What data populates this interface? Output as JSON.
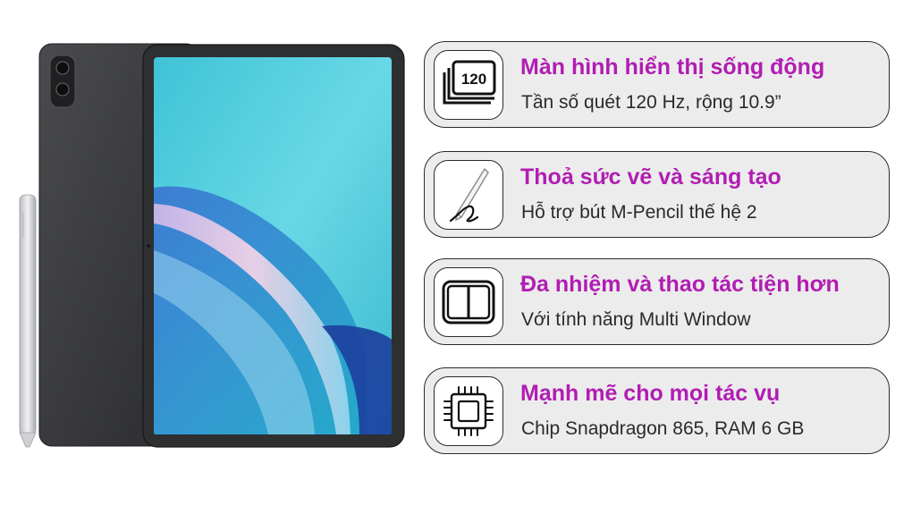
{
  "colors": {
    "accent_title": "#b11db3",
    "card_bg": "#ececec",
    "card_border": "#2b2b2b",
    "screen_cyan": "#5fd2e0",
    "tablet_body": "#3a3b3d"
  },
  "features": [
    {
      "icon": "refresh-rate-120-icon",
      "icon_text": "120",
      "title": "Màn hình hiển thị sống động",
      "subtitle": "Tần số quét 120 Hz, rộng 10.9”"
    },
    {
      "icon": "stylus-pen-icon",
      "title": "Thoả sức vẽ và sáng tạo",
      "subtitle": "Hỗ trợ bút M-Pencil thế hệ 2"
    },
    {
      "icon": "split-window-icon",
      "title": "Đa nhiệm và thao tác tiện hơn",
      "subtitle": "Với tính năng Multi Window"
    },
    {
      "icon": "processor-chip-icon",
      "title": "Mạnh mẽ cho mọi tác vụ",
      "subtitle": "Chip Snapdragon 865, RAM 6 GB"
    }
  ]
}
